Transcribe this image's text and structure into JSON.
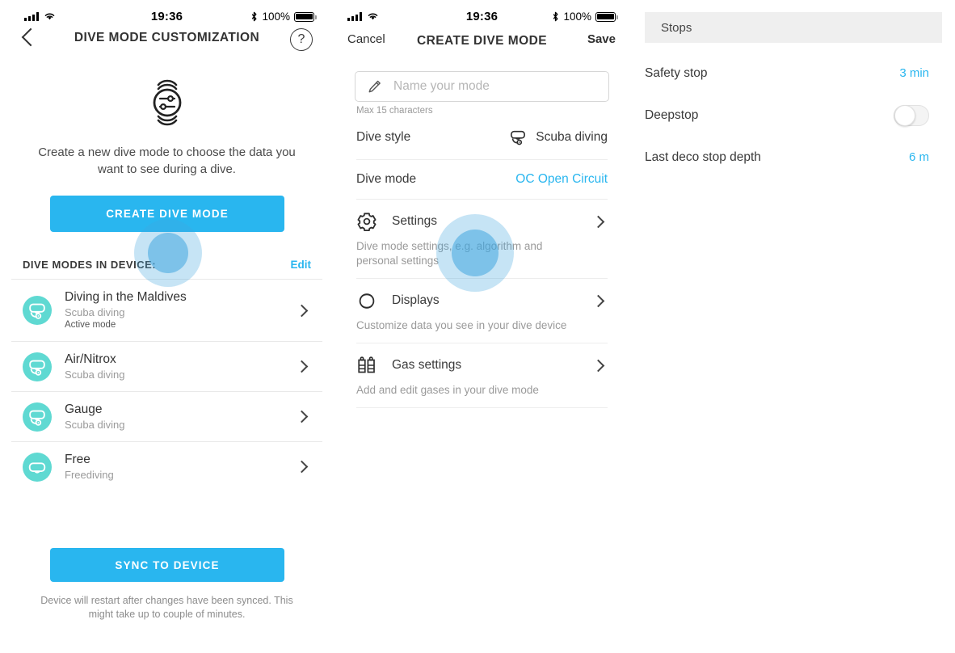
{
  "status_bar": {
    "time": "19:36",
    "battery_percent": "100%",
    "icons": [
      "cellular-signal-icon",
      "wifi-icon",
      "bluetooth-icon",
      "battery-icon"
    ]
  },
  "left_panel": {
    "nav": {
      "back_icon": "chevron-left-icon",
      "title": "DIVE MODE CUSTOMIZATION",
      "help_icon": "question-mark-icon"
    },
    "hero_icon": "dive-watch-settings-icon",
    "hero_text": "Create a new dive mode to choose the data you want to see during a dive.",
    "create_button": "CREATE DIVE MODE",
    "section_title": "DIVE MODES IN DEVICE:",
    "edit_label": "Edit",
    "modes": [
      {
        "icon": "scuba-mask-regulator-icon",
        "title": "Diving in the Maldives",
        "style": "Scuba diving",
        "state": "Active mode"
      },
      {
        "icon": "scuba-mask-regulator-icon",
        "title": "Air/Nitrox",
        "style": "Scuba diving",
        "state": ""
      },
      {
        "icon": "scuba-mask-regulator-icon",
        "title": "Gauge",
        "style": "Scuba diving",
        "state": ""
      },
      {
        "icon": "freedive-mask-icon",
        "title": "Free",
        "style": "Freediving",
        "state": ""
      }
    ],
    "sync_button": "SYNC TO DEVICE",
    "sync_note": "Device will restart after changes have been synced. This might take up to couple of minutes."
  },
  "middle_panel": {
    "nav": {
      "cancel": "Cancel",
      "title": "CREATE DIVE MODE",
      "save": "Save"
    },
    "name_field": {
      "icon": "pencil-icon",
      "value": "",
      "placeholder": "Name your mode",
      "note": "Max 15 characters"
    },
    "dive_style": {
      "label": "Dive style",
      "icon": "scuba-mask-regulator-icon",
      "value": "Scuba diving"
    },
    "dive_mode": {
      "label": "Dive mode",
      "value": "OC Open Circuit"
    },
    "groups": [
      {
        "icon": "gear-icon",
        "title": "Settings",
        "desc": "Dive mode settings, e.g. algorithm and personal settings",
        "chevron": "chevron-right-icon"
      },
      {
        "icon": "watch-icon",
        "title": "Displays",
        "desc": "Customize data you see in your dive device",
        "chevron": "chevron-right-icon"
      },
      {
        "icon": "gas-tanks-icon",
        "title": "Gas settings",
        "desc": "Add and edit gases in your dive mode",
        "chevron": "chevron-right-icon"
      }
    ]
  },
  "right_panel": {
    "header": "Stops",
    "rows": [
      {
        "label": "Safety stop",
        "value": "3 min",
        "type": "value"
      },
      {
        "label": "Deepstop",
        "value": "off",
        "type": "toggle"
      },
      {
        "label": "Last deco stop depth",
        "value": "6 m",
        "type": "value"
      }
    ]
  },
  "colors": {
    "accent": "#29b6ef",
    "teal": "#5fd9d2",
    "ripple": "#42a5de",
    "header_gray": "#efefef"
  }
}
